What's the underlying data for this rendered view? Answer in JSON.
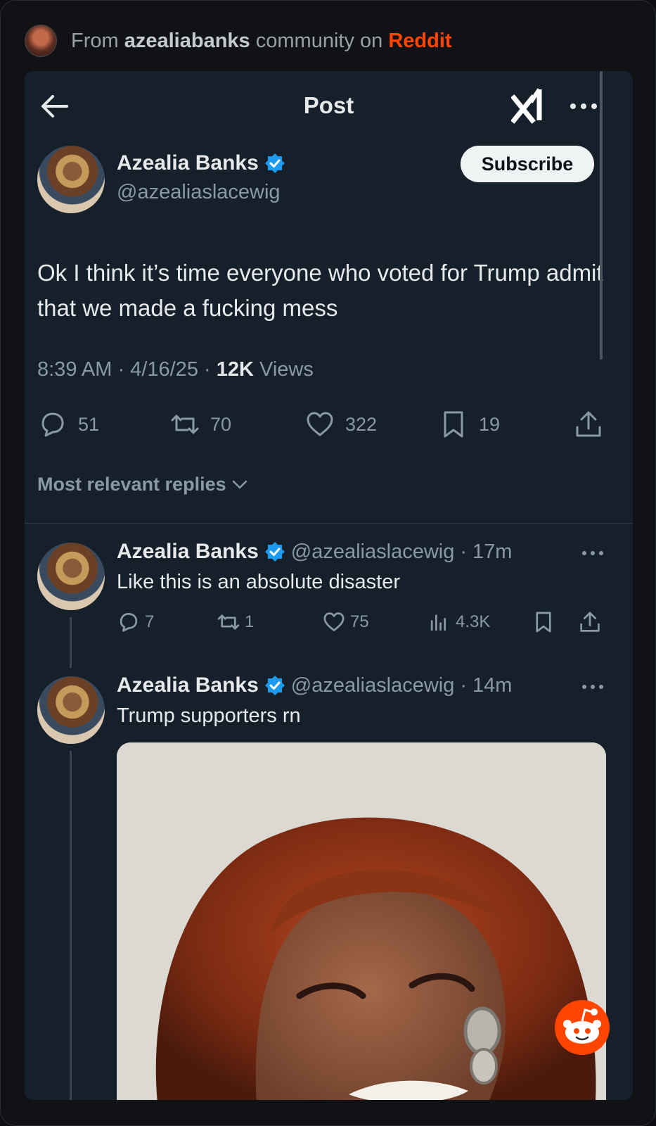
{
  "reddit": {
    "from_text": "From",
    "community": "azealiabanks",
    "community_text": "community on",
    "platform": "Reddit",
    "accent": "#ff4500"
  },
  "topbar": {
    "title": "Post",
    "back_icon": "arrow-left-icon",
    "logo_icon": "xai-logo-icon",
    "more_icon": "more-horizontal-icon"
  },
  "post": {
    "author_name": "Azealia Banks",
    "author_handle": "@azealiaslacewig",
    "subscribe_label": "Subscribe",
    "text": "Ok I think it’s time everyone who voted for Trump admit that we made a fucking mess",
    "time": "8:39 AM",
    "date": "4/16/25",
    "views_count": "12K",
    "views_label": "Views",
    "actions": {
      "replies": "51",
      "reposts": "70",
      "likes": "322",
      "bookmarks": "19"
    },
    "sort_label": "Most relevant replies"
  },
  "replies": [
    {
      "author_name": "Azealia Banks",
      "author_handle": "@azealiaslacewig",
      "age": "17m",
      "text": "Like this is an absolute disaster",
      "replies": "7",
      "reposts": "1",
      "likes": "75",
      "views": "4.3K"
    },
    {
      "author_name": "Azealia Banks",
      "author_handle": "@azealiaslacewig",
      "age": "14m",
      "text": "Trump supporters rn"
    }
  ],
  "colors": {
    "card_bg": "#15202b",
    "verified_blue": "#1d9bf0",
    "muted": "#8b98a5"
  }
}
